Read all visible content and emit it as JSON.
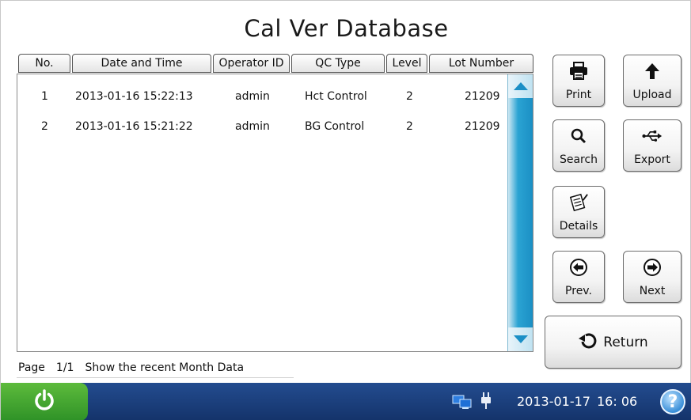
{
  "title": "Cal Ver Database",
  "table": {
    "headers": [
      "No.",
      "Date and Time",
      "Operator ID",
      "QC Type",
      "Level",
      "Lot Number"
    ],
    "rows": [
      [
        "1",
        "2013-01-16 15:22:13",
        "admin",
        "Hct Control",
        "2",
        "21209"
      ],
      [
        "2",
        "2013-01-16 15:21:22",
        "admin",
        "BG Control",
        "2",
        "21209"
      ]
    ]
  },
  "footer": {
    "page_label": "Page",
    "page_value": "1/1",
    "filter_text": "Show the recent Month Data"
  },
  "buttons": {
    "print": "Print",
    "upload": "Upload",
    "search": "Search",
    "export": "Export",
    "details": "Details",
    "prev": "Prev.",
    "next": "Next",
    "return": "Return"
  },
  "icons": {
    "print": "printer-icon",
    "upload": "arrow-up-icon",
    "search": "magnifier-icon",
    "export": "usb-icon",
    "details": "document-pen-icon",
    "prev": "circle-arrow-left-icon",
    "next": "circle-arrow-right-icon",
    "return": "undo-arrow-icon",
    "power": "power-icon",
    "network": "network-icon",
    "plug": "plug-icon",
    "help": "help-icon"
  },
  "status": {
    "date": "2013-01-17",
    "time": "16: 06",
    "help_glyph": "?"
  },
  "colors": {
    "statusbar": "#1b3f7c",
    "power": "#45a832",
    "scrollbar": "#2aa3d3"
  }
}
